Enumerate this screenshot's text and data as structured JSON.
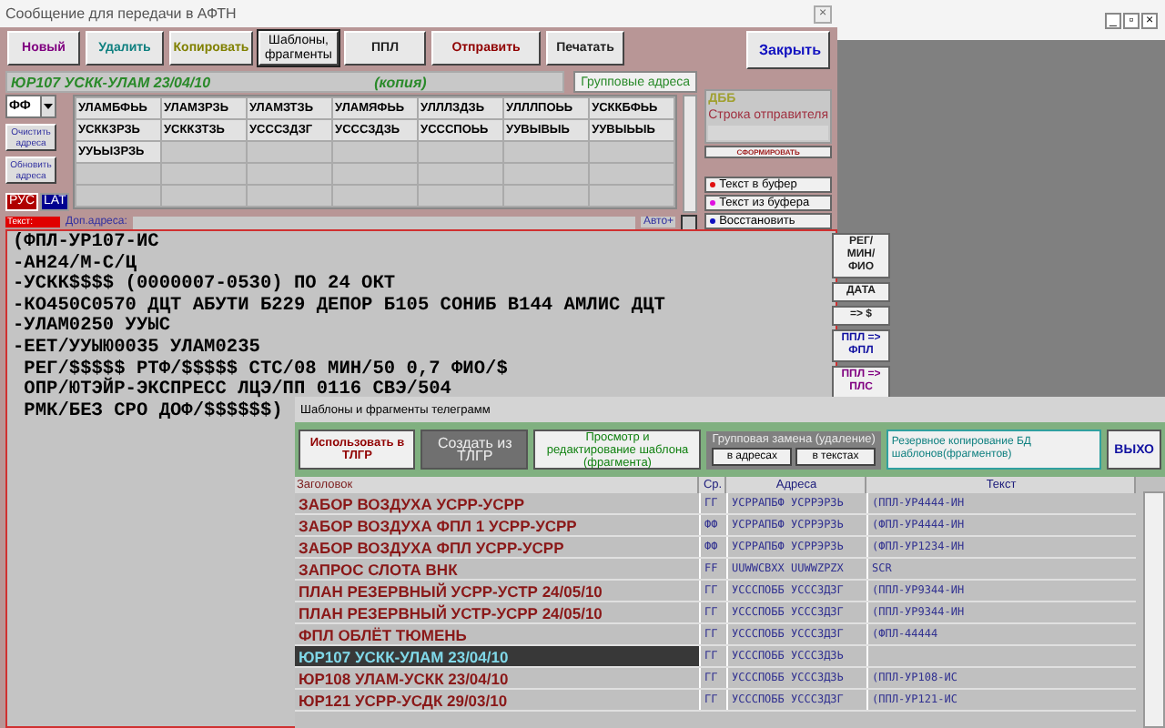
{
  "window": {
    "title": "Сообщение для передачи в АФТН",
    "close": "×",
    "mdi_controls": [
      "_",
      "▫",
      "×"
    ]
  },
  "toolbar": [
    {
      "label": "Новый",
      "kind": "purple"
    },
    {
      "label": "Удалить",
      "kind": "teal"
    },
    {
      "label": "Копировать",
      "kind": "olive"
    },
    {
      "label": "Шаблоны, фрагменты",
      "kind": "boxed"
    },
    {
      "label": "ППЛ",
      "kind": "plain"
    },
    {
      "label": "Отправить",
      "kind": "red"
    },
    {
      "label": "Печатать",
      "kind": "plain"
    }
  ],
  "close_button": "Закрыть",
  "header": {
    "title": "ЮР107 УСКК-УЛАМ 23/04/10",
    "note": "(копия)",
    "group_button": "Групповые адреса"
  },
  "priority": "ФФ",
  "side_buttons": [
    "Очистить адреса",
    "Обновить адреса"
  ],
  "languages": [
    {
      "label": "РУС",
      "selected": true
    },
    {
      "label": "LAT",
      "selected": false
    }
  ],
  "addresses": [
    "УЛАМБФЬЬ",
    "УЛАМЗРЗЬ",
    "УЛАМЗТЗЬ",
    "УЛАМЯФЬЬ",
    "УЛЛЛЗДЗЬ",
    "УЛЛЛПОЬЬ",
    "УСККБФЬЬ",
    "УСККЗРЗЬ",
    "УСККЗТЗЬ",
    "УСССЗДЗГ",
    "УСССЗДЗЬ",
    "УСССПОЬЬ",
    "УУВЫВЫЬ",
    "УУВЫЬЫЬ",
    "УУЬЫЗРЗЬ"
  ],
  "extra_address_label": "Доп.адреса:",
  "auto": {
    "label": "Авто+",
    "checked": false
  },
  "text_label": "Текст:",
  "sender": {
    "code": "ДББ",
    "label": "Строка отправителя",
    "button": "СФОРМИРОВАТЬ"
  },
  "buffer_buttons": [
    {
      "label": "Текст в буфер",
      "color": "#e01010"
    },
    {
      "label": "Текст из буфера",
      "color": "#e010e0"
    },
    {
      "label": "Восстановить",
      "color": "#1010c0"
    }
  ],
  "message_lines": [
    "(ФПЛ-УР107-ИС",
    "-АН24/М-С/Ц",
    "-УСКК$$$$ (0000007-0530) ПО 24 ОКТ",
    "-КО450С0570 ДЦТ АБУТИ Б229 ДЕПОР Б105 СОНИБ В144 АМЛИС ДЦТ",
    "-УЛАМ0250 УУЫС",
    "-ЕЕТ/УУЫЮ0035 УЛАМ0235",
    " РЕГ/$$$$$ РТФ/$$$$$ СТС/08 МИН/50 0,7 ФИО/$",
    " ОПР/ЮТЭЙР-ЭКСПРЕСС ЛЦЭ/ПП 0116 СВЭ/504",
    " РМК/БЕЗ СРО ДОФ/$$$$$$)"
  ],
  "right_buttons": [
    {
      "label": "РЕГ/ МИН/ ФИО",
      "kind": "plain"
    },
    {
      "label": "ДАТА",
      "kind": "plain"
    },
    {
      "label": "=> $",
      "kind": "plain"
    },
    {
      "label": "ППЛ => ФПЛ",
      "kind": "blue"
    },
    {
      "label": "ППЛ => ПЛС",
      "kind": "purple"
    }
  ],
  "templates": {
    "title": "Шаблоны и фрагменты телеграмм",
    "buttons": [
      {
        "label": "Использовать в ТЛГР",
        "kind": "red"
      },
      {
        "label": "Создать из ТЛГР",
        "kind": "disabled"
      },
      {
        "label": "Просмотр и редактирование шаблона (фрагмента)",
        "kind": "green"
      }
    ],
    "group_replace": {
      "title": "Групповая замена (удаление)",
      "buttons": [
        "в адресах",
        "в текстах"
      ]
    },
    "backup_button": "Резервное копирование БД шаблонов(фрагментов)",
    "exit_button": "ВЫХО",
    "columns": [
      "Заголовок",
      "Ср.",
      "Адреса",
      "Текст"
    ],
    "rows": [
      {
        "title": "ЗАБОР ВОЗДУХА УСРР-УСРР",
        "priority": "ГГ",
        "addresses": "УСРРАПБФ УСРРЭРЗЬ",
        "text": "(ППЛ-УР4444-ИН",
        "selected": false
      },
      {
        "title": "ЗАБОР ВОЗДУХА ФПЛ 1 УСРР-УСРР",
        "priority": "ФФ",
        "addresses": "УСРРАПБФ УСРРЭРЗЬ",
        "text": "(ФПЛ-УР4444-ИН",
        "selected": false
      },
      {
        "title": "ЗАБОР ВОЗДУХА ФПЛ УСРР-УСРР",
        "priority": "ФФ",
        "addresses": "УСРРАПБФ УСРРЭРЗЬ",
        "text": "(ФПЛ-УР1234-ИН",
        "selected": false
      },
      {
        "title": "ЗАПРОС СЛОТА ВНК",
        "priority": "FF",
        "addresses": "UUWWCBXX UUWWZPZX",
        "text": "SCR",
        "selected": false
      },
      {
        "title": "ПЛАН РЕЗЕРВНЫЙ УСРР-УСТР 24/05/10",
        "priority": "ГГ",
        "addresses": "УСССПОББ УСССЗДЗГ",
        "text": "(ППЛ-УР9344-ИН",
        "selected": false
      },
      {
        "title": "ПЛАН РЕЗЕРВНЫЙ УСТР-УСРР 24/05/10",
        "priority": "ГГ",
        "addresses": "УСССПОББ УСССЗДЗГ",
        "text": "(ППЛ-УР9344-ИН",
        "selected": false
      },
      {
        "title": "ФПЛ ОБЛЁТ ТЮМЕНЬ",
        "priority": "ГГ",
        "addresses": "УСССПОББ УСССЗДЗГ",
        "text": "(ФПЛ-44444",
        "selected": false
      },
      {
        "title": "ЮР107 УСКК-УЛАМ 23/04/10",
        "priority": "ГГ",
        "addresses": "УСССПОББ УСССЗДЗЬ",
        "selected": true
      },
      {
        "title": "ЮР108 УЛАМ-УСКК 23/04/10",
        "priority": "ГГ",
        "addresses": "УСССПОББ УСССЗДЗЬ",
        "text": "(ППЛ-УР108-ИС",
        "selected": false
      },
      {
        "title": "ЮР121 УСРР-УСДК 29/03/10",
        "priority": "ГГ",
        "addresses": "УСССПОББ УСССЗДЗГ",
        "text": "(ППЛ-УР121-ИС",
        "selected": false
      }
    ]
  }
}
